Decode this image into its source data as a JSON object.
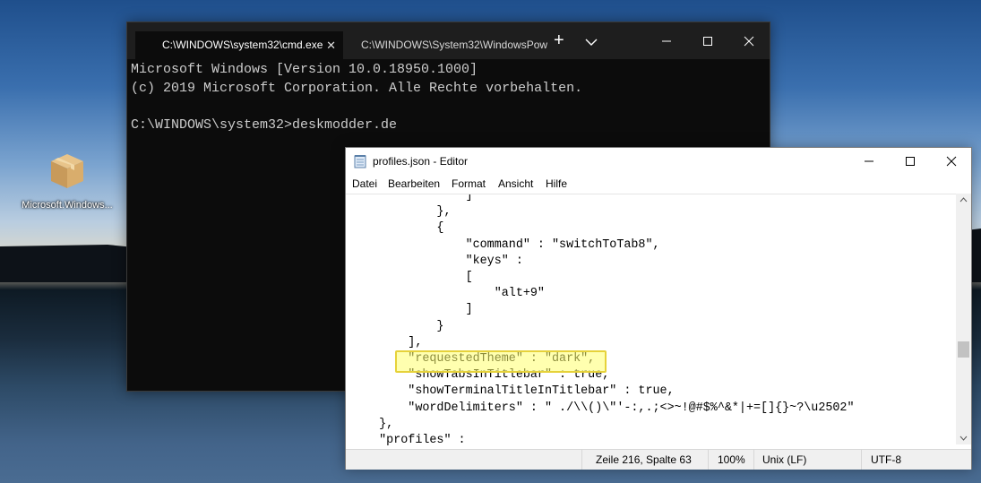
{
  "desktop": {
    "icon_label": "Microsoft.Windows..."
  },
  "terminal": {
    "tabs": [
      {
        "label": "C:\\WINDOWS\\system32\\cmd.exe",
        "close": "✕"
      },
      {
        "label": "C:\\WINDOWS\\System32\\WindowsPowe"
      }
    ],
    "new_tab": "+",
    "output": "Microsoft Windows [Version 10.0.18950.1000]\n(c) 2019 Microsoft Corporation. Alle Rechte vorbehalten.\n\nC:\\WINDOWS\\system32>deskmodder.de"
  },
  "notepad": {
    "title": "profiles.json - Editor",
    "menu": [
      "Datei",
      "Bearbeiten",
      "Format",
      "Ansicht",
      "Hilfe"
    ],
    "content": "                ]\n            },\n            {\n                \"command\" : \"switchToTab8\",\n                \"keys\" :\n                [\n                    \"alt+9\"\n                ]\n            }\n        ],\n        \"requestedTheme\" : \"dark\",\n        \"showTabsInTitlebar\" : true,\n        \"showTerminalTitleInTitlebar\" : true,\n        \"wordDelimiters\" : \" ./\\\\()\\\"'-:,.;<>~!@#$%^&*|+=[]{}~?\\u2502\"\n    },\n    \"profiles\" :",
    "status": {
      "position": "Zeile 216, Spalte 63",
      "zoom": "100%",
      "line_endings": "Unix (LF)",
      "encoding": "UTF-8"
    }
  },
  "colors": {
    "terminal_bg": "#0c0c0c",
    "highlight": "#ffff6e"
  }
}
